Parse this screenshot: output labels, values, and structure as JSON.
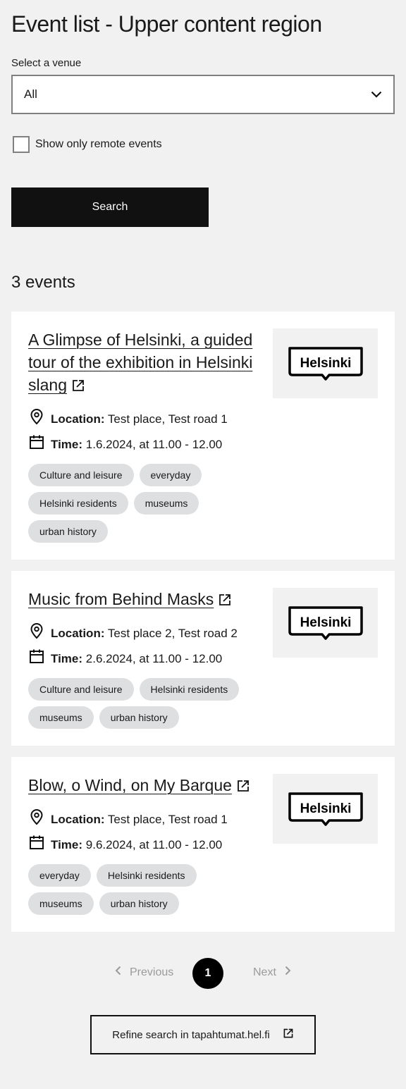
{
  "page_title": "Event list - Upper content region",
  "venue": {
    "label": "Select a venue",
    "selected": "All"
  },
  "remote": {
    "label": "Show only remote events",
    "checked": false
  },
  "search_label": "Search",
  "event_count": "3 events",
  "location_label": "Location:",
  "time_label": "Time:",
  "logo_text": "Helsinki",
  "events": [
    {
      "title": "A Glimpse of Helsinki, a guided tour of the exhibition in Helsinki slang",
      "location": "Test place, Test road 1",
      "time": "1.6.2024, at 11.00 - 12.00",
      "tags": [
        "Culture and leisure",
        "everyday",
        "Helsinki residents",
        "museums",
        "urban history"
      ]
    },
    {
      "title": "Music from Behind Masks",
      "location": "Test place 2, Test road 2",
      "time": "2.6.2024, at 11.00 - 12.00",
      "tags": [
        "Culture and leisure",
        "Helsinki residents",
        "museums",
        "urban history"
      ]
    },
    {
      "title": "Blow, o Wind, on My Barque",
      "location": "Test place, Test road 1",
      "time": "9.6.2024, at 11.00 - 12.00",
      "tags": [
        "everyday",
        "Helsinki residents",
        "museums",
        "urban history"
      ]
    }
  ],
  "pagination": {
    "previous": "Previous",
    "current": "1",
    "next": "Next"
  },
  "refine_label": "Refine search in tapahtumat.hel.fi",
  "icons": {
    "select": "chevron-down-icon",
    "location": "location-pin-icon",
    "time": "calendar-icon",
    "external": "external-link-icon",
    "prev": "chevron-left-icon",
    "next": "chevron-right-icon"
  }
}
